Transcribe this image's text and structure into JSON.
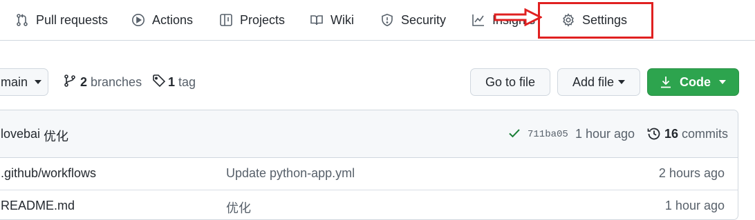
{
  "nav": {
    "tabs": [
      {
        "label": "Pull requests",
        "icon": "pull-request-icon"
      },
      {
        "label": "Actions",
        "icon": "play-icon"
      },
      {
        "label": "Projects",
        "icon": "table-icon"
      },
      {
        "label": "Wiki",
        "icon": "book-icon"
      },
      {
        "label": "Security",
        "icon": "shield-icon"
      },
      {
        "label": "Insights",
        "icon": "graph-icon"
      },
      {
        "label": "Settings",
        "icon": "gear-icon"
      }
    ]
  },
  "annotation": {
    "color": "#e02020"
  },
  "toolbar": {
    "branch": "main",
    "branches_count": "2",
    "branches_label": "branches",
    "tags_count": "1",
    "tags_label": "tag",
    "go_to_file": "Go to file",
    "add_file": "Add file",
    "code": "Code"
  },
  "latest_commit": {
    "author": "lovebai",
    "message": "优化",
    "sha": "711ba05",
    "time": "1 hour ago",
    "commits_count": "16",
    "commits_label": "commits"
  },
  "files": [
    {
      "name": ".github/workflows",
      "message": "Update python-app.yml",
      "time": "2 hours ago"
    },
    {
      "name": "README.md",
      "message": "优化",
      "time": "1 hour ago"
    }
  ],
  "colors": {
    "accent_green": "#2da44e",
    "border": "#d0d7de",
    "muted_text": "#57606a"
  }
}
